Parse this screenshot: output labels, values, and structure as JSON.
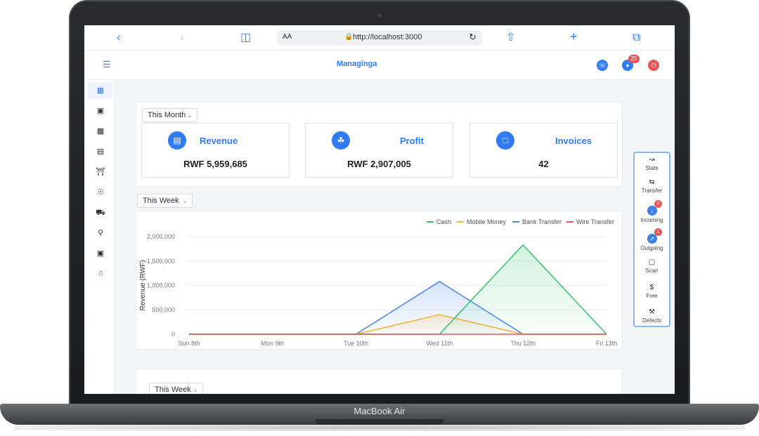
{
  "device": {
    "label": "MacBook Air"
  },
  "browser": {
    "text_size_label": "AA",
    "address": "http://localhost:3000"
  },
  "app": {
    "title": "Managinga",
    "notification_count": "25",
    "header_icons": [
      "headset-icon",
      "bell-icon",
      "power-icon"
    ]
  },
  "sidebar": {
    "items": [
      {
        "icon": "dashboard-icon",
        "active": true
      },
      {
        "icon": "building-icon"
      },
      {
        "icon": "apps-icon"
      },
      {
        "icon": "bag-icon"
      },
      {
        "icon": "bank-icon"
      },
      {
        "icon": "dollar-icon"
      },
      {
        "icon": "truck-icon"
      },
      {
        "icon": "cart-icon"
      },
      {
        "icon": "wallet-icon"
      },
      {
        "icon": "users-icon"
      }
    ]
  },
  "summary": {
    "period": "This Month",
    "cards": [
      {
        "label": "Revenue",
        "value": "RWF 5,959,685",
        "icon": "money-icon"
      },
      {
        "label": "Profit",
        "value": "RWF 2,907,005",
        "icon": "hand-coins-icon"
      },
      {
        "label": "Invoices",
        "value": "42",
        "icon": "document-icon"
      }
    ]
  },
  "chart_section": {
    "period": "This Week"
  },
  "bottom_section": {
    "period": "This Week"
  },
  "chart_data": {
    "type": "area",
    "title": "",
    "xlabel": "",
    "ylabel": "Revenue (RWF)",
    "categories": [
      "Sun 8th",
      "Mon 9th",
      "Tue 10th",
      "Wed 11th",
      "Thu 12th",
      "Fri 13th"
    ],
    "ylim": [
      0,
      2000000
    ],
    "yticks": [
      "2,000,000",
      "1,500,000",
      "1,000,000",
      "500,000",
      "0"
    ],
    "ytick_values": [
      2000000,
      1500000,
      1000000,
      500000,
      0
    ],
    "grid": true,
    "legend_position": "top-right",
    "series": [
      {
        "name": "Cash",
        "color": "#35c46b",
        "values": [
          0,
          0,
          0,
          0,
          1830000,
          0
        ]
      },
      {
        "name": "Mobile Money",
        "color": "#f0b43c",
        "values": [
          0,
          0,
          0,
          400000,
          0,
          0
        ]
      },
      {
        "name": "Bank Transfer",
        "color": "#4a86e8",
        "values": [
          0,
          0,
          0,
          1080000,
          0,
          0
        ]
      },
      {
        "name": "Wire Transfer",
        "color": "#e95454",
        "values": [
          0,
          0,
          0,
          0,
          0,
          0
        ]
      }
    ]
  },
  "quick_panel": {
    "items": [
      {
        "label": "Stats",
        "icon": "chart-line-icon"
      },
      {
        "label": "Transfer",
        "icon": "transfer-icon"
      },
      {
        "label": "Incoming",
        "icon": "arrow-down-circle-icon",
        "badge": "0"
      },
      {
        "label": "Outgoing",
        "icon": "arrow-up-circle-icon",
        "badge": "1"
      },
      {
        "label": "Scan",
        "icon": "scanner-icon"
      },
      {
        "label": "Free",
        "icon": "dollar-slash-icon"
      },
      {
        "label": "Defects",
        "icon": "hammer-icon"
      }
    ]
  }
}
